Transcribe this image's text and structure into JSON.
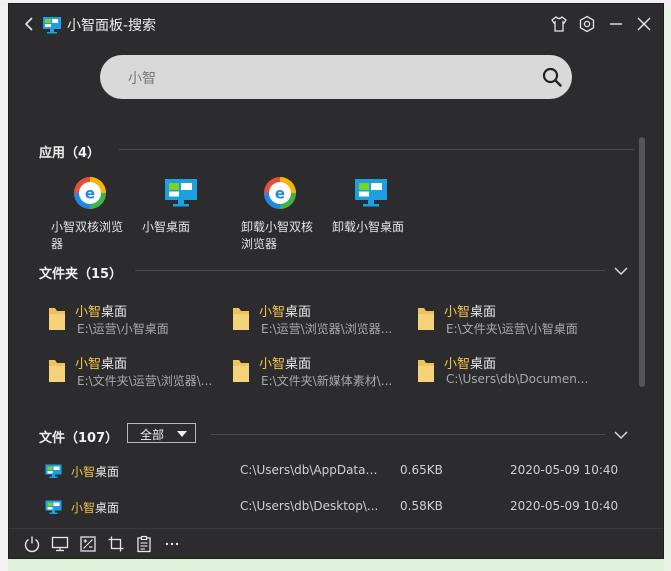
{
  "window": {
    "title": "小智面板-搜索"
  },
  "search": {
    "value": "小智"
  },
  "apps": {
    "header": "应用（4）",
    "items": [
      {
        "label": "小智双核浏览器",
        "icon": "browser-icon"
      },
      {
        "label": "小智桌面",
        "icon": "desktop-app-icon"
      },
      {
        "label": "卸载小智双核浏览器",
        "icon": "browser-icon"
      },
      {
        "label": "卸载小智桌面",
        "icon": "desktop-app-icon"
      }
    ]
  },
  "folders": {
    "header": "文件夹（15）",
    "items": [
      {
        "name_hl": "小智",
        "name_rest": "桌面",
        "path": "E:\\运营\\小智桌面"
      },
      {
        "name_hl": "小智",
        "name_rest": "桌面",
        "path": "E:\\运营\\浏览器\\浏览器..."
      },
      {
        "name_hl": "小智",
        "name_rest": "桌面",
        "path": "E:\\文件夹\\运营\\小智桌面"
      },
      {
        "name_hl": "小智",
        "name_rest": "桌面",
        "path": "E:\\文件夹\\运营\\浏览器\\..."
      },
      {
        "name_hl": "小智",
        "name_rest": "桌面",
        "path": "E:\\文件夹\\新媒体素材\\..."
      },
      {
        "name_hl": "小智",
        "name_rest": "桌面",
        "path": "C:\\Users\\db\\Documen..."
      }
    ]
  },
  "files": {
    "header": "文件（107）",
    "filter": "全部",
    "rows": [
      {
        "name_hl": "小智",
        "name_rest": "桌面",
        "path": "C:\\Users\\db\\AppData\\R...",
        "size": "0.65KB",
        "date": "2020-05-09 10:40"
      },
      {
        "name_hl": "小智",
        "name_rest": "桌面",
        "path": "C:\\Users\\db\\Desktop\\...",
        "size": "0.58KB",
        "date": "2020-05-09 10:40"
      }
    ]
  },
  "colors": {
    "background": "#2c2c2f",
    "highlight": "#f2c24a",
    "search": "#d9d9d9"
  },
  "icons": {
    "titlebar": [
      "back-icon",
      "app-logo-icon",
      "skin-icon",
      "settings-icon",
      "minimize-icon",
      "close-icon"
    ],
    "bottombar": [
      "power-icon",
      "monitor-icon",
      "calculator-icon",
      "crop-icon",
      "clipboard-icon",
      "more-icon"
    ]
  }
}
